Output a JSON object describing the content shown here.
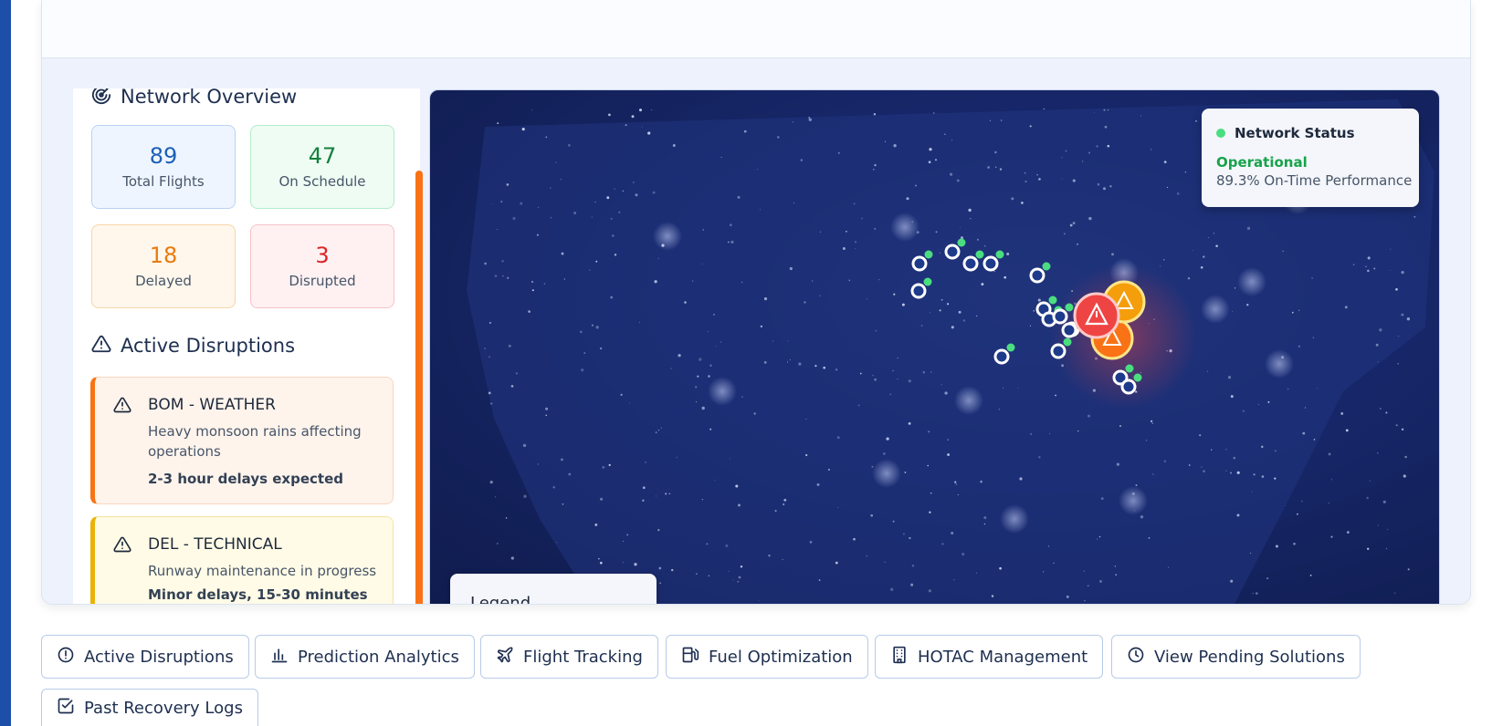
{
  "network_overview": {
    "title": "Network Overview",
    "stats": [
      {
        "value": "89",
        "label": "Total Flights",
        "color": "#1d5fb6"
      },
      {
        "value": "47",
        "label": "On Schedule",
        "color": "#15803d"
      },
      {
        "value": "18",
        "label": "Delayed",
        "color": "#ea7a0c"
      },
      {
        "value": "3",
        "label": "Disrupted",
        "color": "#dc2626"
      }
    ]
  },
  "active_disruptions": {
    "title": "Active Disruptions",
    "items": [
      {
        "title": "BOM - WEATHER",
        "description": "Heavy monsoon rains affecting operations",
        "impact": "2-3 hour delays expected",
        "accent": "#f97316"
      },
      {
        "title": "DEL - TECHNICAL",
        "description": "Runway maintenance in progress",
        "impact": "Minor delays, 15-30 minutes",
        "accent": "#eab308"
      }
    ]
  },
  "map": {
    "status_title": "Network Status",
    "status_value": "Operational",
    "performance": "89.3% On-Time Performance",
    "legend_title": "Legend",
    "status_color": "#16a34a",
    "alert_colors": [
      "#ef4444",
      "#f59e0b",
      "#f97316"
    ]
  },
  "actions": {
    "buttons": [
      {
        "label": "Active Disruptions",
        "icon": "alert-circle-icon"
      },
      {
        "label": "Prediction Analytics",
        "icon": "bar-chart-icon"
      },
      {
        "label": "Flight Tracking",
        "icon": "plane-icon"
      },
      {
        "label": "Fuel Optimization",
        "icon": "fuel-icon"
      },
      {
        "label": "HOTAC Management",
        "icon": "building-icon"
      },
      {
        "label": "View Pending Solutions",
        "icon": "clock-icon"
      },
      {
        "label": "Past Recovery Logs",
        "icon": "check-square-icon"
      }
    ]
  }
}
